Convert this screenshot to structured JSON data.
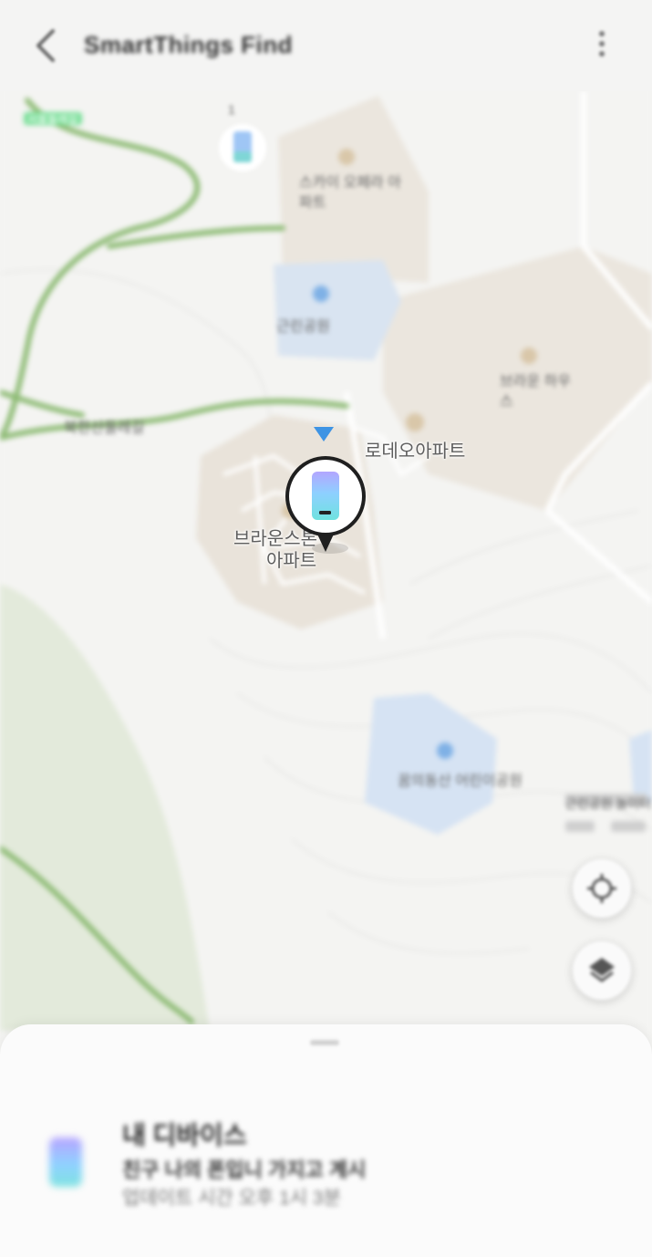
{
  "header": {
    "title": "SmartThings Find",
    "back_icon": "back-arrow-icon",
    "more_icon": "more-vertical-icon"
  },
  "map": {
    "labels": {
      "green_tag": "서울둘레길",
      "area1": "스카이 오페라 아파트",
      "park1": "근린공원",
      "area2": "브라운 하우스",
      "main_complex": "브라운스톤",
      "main_complex_line2": "아파트",
      "rodeo": "로데오아파트",
      "park2": "꿈의동산 어린이공원",
      "trail": "북한산둘레길",
      "right_edge": "근린공원 놀이터"
    },
    "small_pin_label": "1"
  },
  "controls": {
    "locate_icon": "crosshair-icon",
    "layers_icon": "layers-icon"
  },
  "colors": {
    "direction_arrow": "#3e94e4",
    "pin_ring": "#1f1f1f",
    "park_green": "#7fb069",
    "building_beige": "#e9e2d8",
    "water_blue": "#cfe0f4"
  },
  "device": {
    "name": "내 디바이스",
    "status": "친구 나의 폰입니 가지고 계시",
    "updated": "업데이트 시간 오후 1시 3분"
  }
}
